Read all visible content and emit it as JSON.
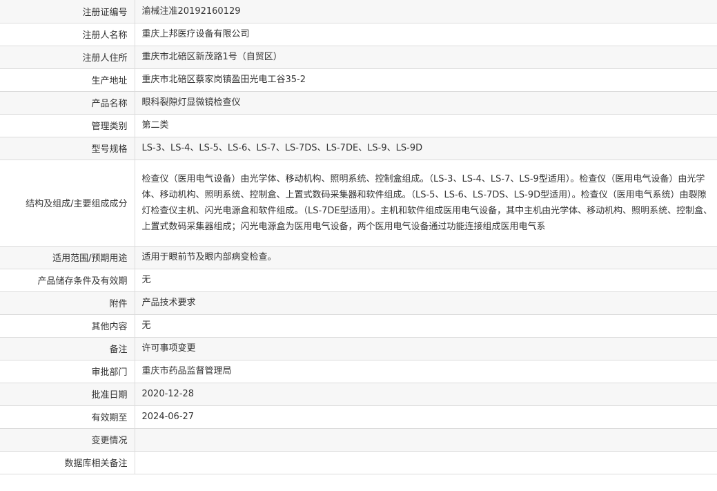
{
  "rows": [
    {
      "label": "注册证编号",
      "value": "渝械注准20192160129"
    },
    {
      "label": "注册人名称",
      "value": "重庆上邦医疗设备有限公司"
    },
    {
      "label": "注册人住所",
      "value": "重庆市北碚区新茂路1号（自贸区）"
    },
    {
      "label": "生产地址",
      "value": "重庆市北碚区蔡家岗镇盈田光电工谷35-2"
    },
    {
      "label": "产品名称",
      "value": "眼科裂隙灯显微镜检查仪"
    },
    {
      "label": "管理类别",
      "value": "第二类"
    },
    {
      "label": "型号规格",
      "value": "LS-3、LS-4、LS-5、LS-6、LS-7、LS-7DS、LS-7DE、LS-9、LS-9D"
    },
    {
      "label": "结构及组成/主要组成成分",
      "value": "检查仪（医用电气设备）由光学体、移动机构、照明系统、控制盒组成。（LS-3、LS-4、LS-7、LS-9型适用）。检查仪（医用电气设备）由光学体、移动机构、照明系统、控制盒、上置式数码采集器和软件组成。（LS-5、LS-6、LS-7DS、LS-9D型适用）。检查仪（医用电气系统）由裂隙灯检查仪主机、闪光电源盒和软件组成。（LS-7DE型适用）。主机和软件组成医用电气设备，其中主机由光学体、移动机构、照明系统、控制盒、上置式数码采集器组成；闪光电源盒为医用电气设备，两个医用电气设备通过功能连接组成医用电气系"
    },
    {
      "label": "适用范围/预期用途",
      "value": "适用于眼前节及眼内部病变检查。"
    },
    {
      "label": "产品储存条件及有效期",
      "value": "无"
    },
    {
      "label": "附件",
      "value": "产品技术要求"
    },
    {
      "label": "其他内容",
      "value": "无"
    },
    {
      "label": "备注",
      "value": "许可事项变更"
    },
    {
      "label": "审批部门",
      "value": "重庆市药品监督管理局"
    },
    {
      "label": "批准日期",
      "value": "2020-12-28"
    },
    {
      "label": "有效期至",
      "value": "2024-06-27"
    },
    {
      "label": "变更情况",
      "value": ""
    },
    {
      "label": "数据库相关备注",
      "value": ""
    }
  ]
}
